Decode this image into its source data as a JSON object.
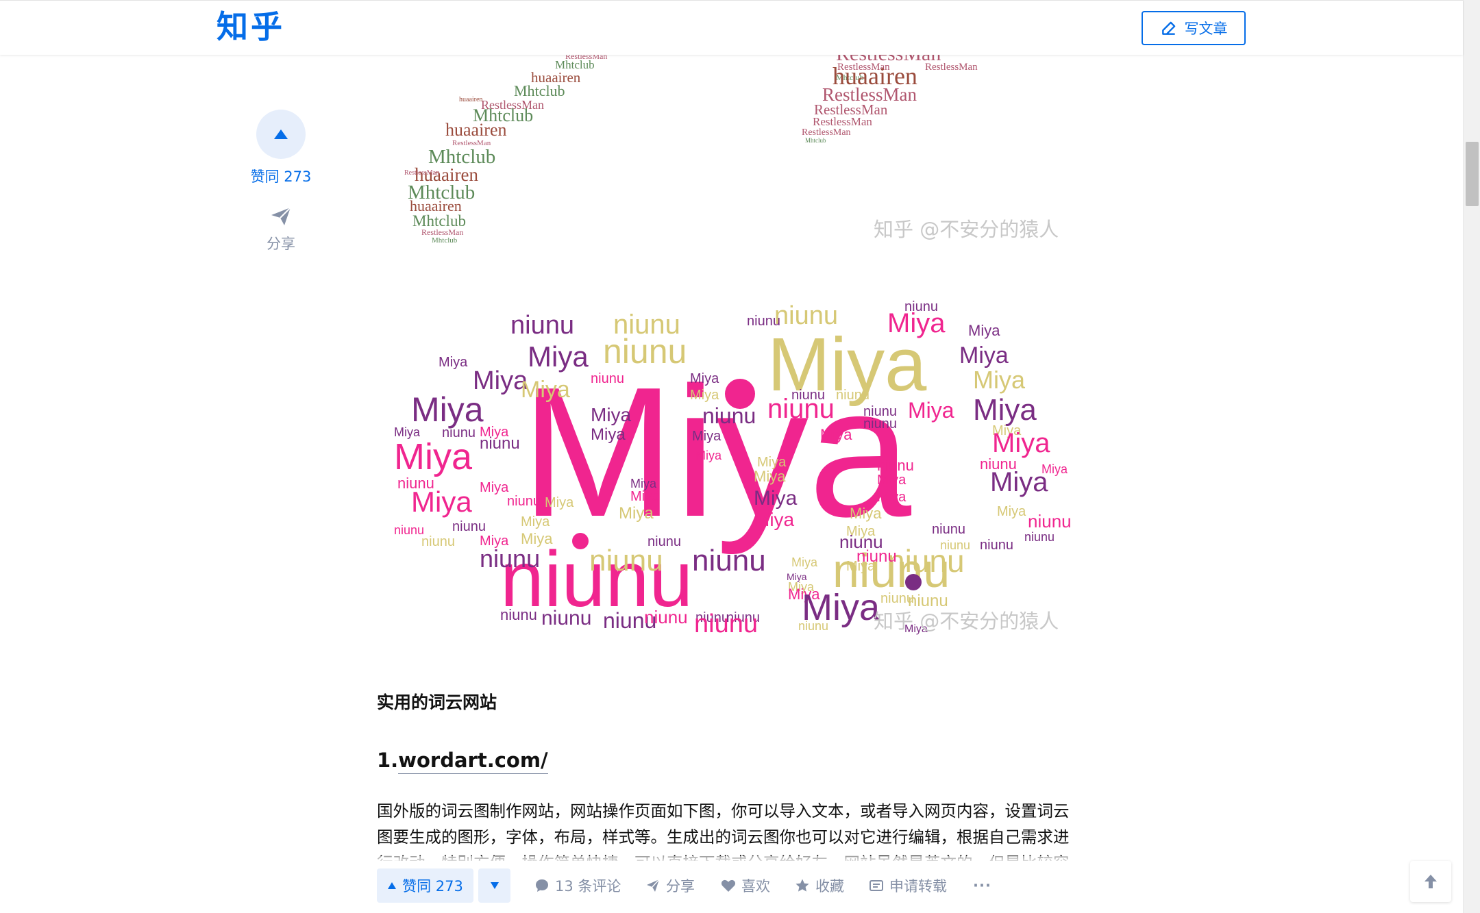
{
  "header": {
    "logo": "知乎",
    "write_article_label": "写文章"
  },
  "side": {
    "vote_count_label": "赞同 273",
    "share_label": "分享"
  },
  "images": {
    "watermark": "知乎 @不安分的猿人",
    "top_words": [
      "RestlessMan",
      "huaairen",
      "Mhtclub"
    ],
    "cloud_words": [
      "Miya",
      "niunu"
    ],
    "colors": {
      "pink": "#f0258f",
      "khaki": "#d6c875",
      "purple": "#7a2d83",
      "green": "#5c8a58",
      "brown": "#9a4b3c",
      "mauve": "#b0566e"
    }
  },
  "article": {
    "section_title": "实用的词云网站",
    "site_heading_prefix": "1.",
    "site_heading_link": "wordart.com/",
    "paragraph": "国外版的词云图制作网站，网站操作页面如下图，你可以导入文本，或者导入网页内容，设置词云图要生成的图形，字体，布局，样式等。生成出的词云图你也可以对它进行编辑，根据自己需求进行改动，特别方便。操作简单快捷，可以直接下载或分享给好友，网站虽然是英文的，但是比较容易上手。"
  },
  "action_bar": {
    "vote_up_label": "赞同 273",
    "comments_label": "13 条评论",
    "share_label": "分享",
    "like_label": "喜欢",
    "collect_label": "收藏",
    "repost_label": "申请转载",
    "more_label": "···"
  },
  "colors": {
    "brand": "#056de8",
    "muted": "#8590a6",
    "text": "#121212"
  }
}
